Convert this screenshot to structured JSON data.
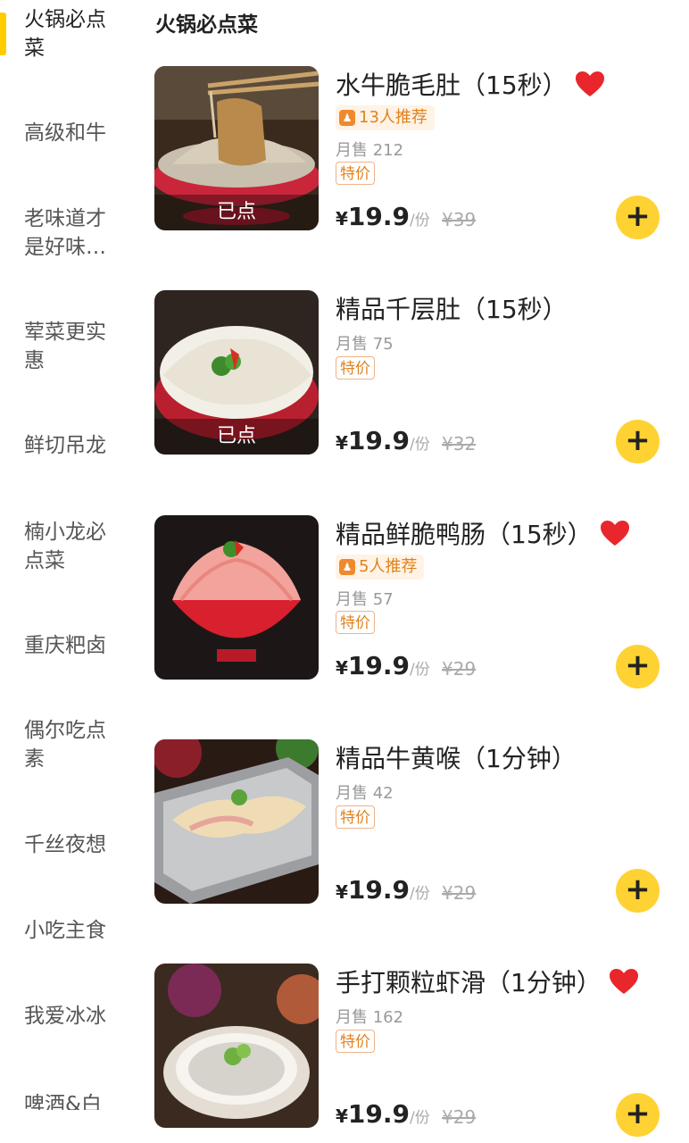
{
  "sidebar": {
    "items": [
      {
        "label": "火锅必点\n菜",
        "active": true
      },
      {
        "label": "高级和牛"
      },
      {
        "label": "老味道才\n是好味…"
      },
      {
        "label": "荤菜更实\n惠"
      },
      {
        "label": "鲜切吊龙"
      },
      {
        "label": "楠小龙必\n点菜"
      },
      {
        "label": "重庆粑卤"
      },
      {
        "label": "偶尔吃点\n素"
      },
      {
        "label": "千丝夜想"
      },
      {
        "label": "小吃主食"
      },
      {
        "label": "我爱冰冰"
      },
      {
        "label": "啤酒&白"
      }
    ]
  },
  "main": {
    "section_title": "火锅必点菜",
    "items": [
      {
        "name": "水牛脆毛肚（15秒）",
        "liked": true,
        "recommend": "13人推荐",
        "sales": "月售 212",
        "tag": "特价",
        "currency": "¥",
        "price": "19.9",
        "unit": "/份",
        "original_price": "¥39",
        "ordered": "已点",
        "image": "beef-tripe-hotpot-dish"
      },
      {
        "name": "精品千层肚（15秒）",
        "liked": false,
        "recommend": "",
        "sales": "月售 75",
        "tag": "特价",
        "currency": "¥",
        "price": "19.9",
        "unit": "/份",
        "original_price": "¥32",
        "ordered": "已点",
        "image": "white-tripe-plate"
      },
      {
        "name": "精品鲜脆鸭肠（15秒）",
        "liked": true,
        "recommend": "5人推荐",
        "sales": "月售 57",
        "tag": "特价",
        "currency": "¥",
        "price": "19.9",
        "unit": "/份",
        "original_price": "¥29",
        "ordered": "",
        "image": "duck-intestine-bowl"
      },
      {
        "name": "精品牛黄喉（1分钟）",
        "liked": false,
        "recommend": "",
        "sales": "月售 42",
        "tag": "特价",
        "currency": "¥",
        "price": "19.9",
        "unit": "/份",
        "original_price": "¥29",
        "ordered": "",
        "image": "beef-aorta-tray"
      },
      {
        "name": "手打颗粒虾滑（1分钟）",
        "liked": true,
        "recommend": "",
        "sales": "月售 162",
        "tag": "特价",
        "currency": "¥",
        "price": "19.9",
        "unit": "/份",
        "original_price": "¥29",
        "ordered": "",
        "image": "shrimp-paste-bowl"
      }
    ],
    "add_button_label": "+"
  },
  "colors": {
    "accent": "#ffd233",
    "active_bar": "#ffcc00",
    "tag": "#e0821f",
    "heart": "#e8262c"
  },
  "icons": {
    "heart": "heart-icon",
    "recommend": "thumb-up-icon",
    "add": "plus-icon"
  }
}
